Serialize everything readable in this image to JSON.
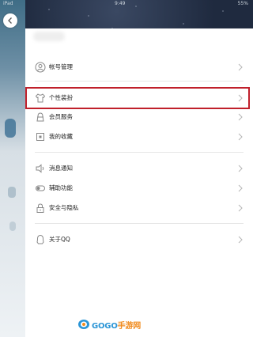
{
  "status_bar": {
    "left": "iPad",
    "center": "9:49",
    "right": "55%"
  },
  "menu": {
    "group1": [
      {
        "label": "帐号管理",
        "icon": "user-icon"
      }
    ],
    "group2": [
      {
        "label": "个性装扮",
        "icon": "shirt-icon"
      },
      {
        "label": "会员服务",
        "icon": "crown-icon"
      },
      {
        "label": "我的收藏",
        "icon": "bookmark-icon"
      }
    ],
    "group3": [
      {
        "label": "消息通知",
        "icon": "speaker-icon"
      },
      {
        "label": "辅助功能",
        "icon": "toggle-icon"
      },
      {
        "label": "安全与隐私",
        "icon": "lock-icon"
      }
    ],
    "group4": [
      {
        "label": "关于QQ",
        "icon": "penguin-icon"
      }
    ]
  },
  "colors": {
    "highlight": "#c0202b"
  },
  "watermark": {
    "prefix": "GOGO",
    "suffix": "手游网"
  }
}
